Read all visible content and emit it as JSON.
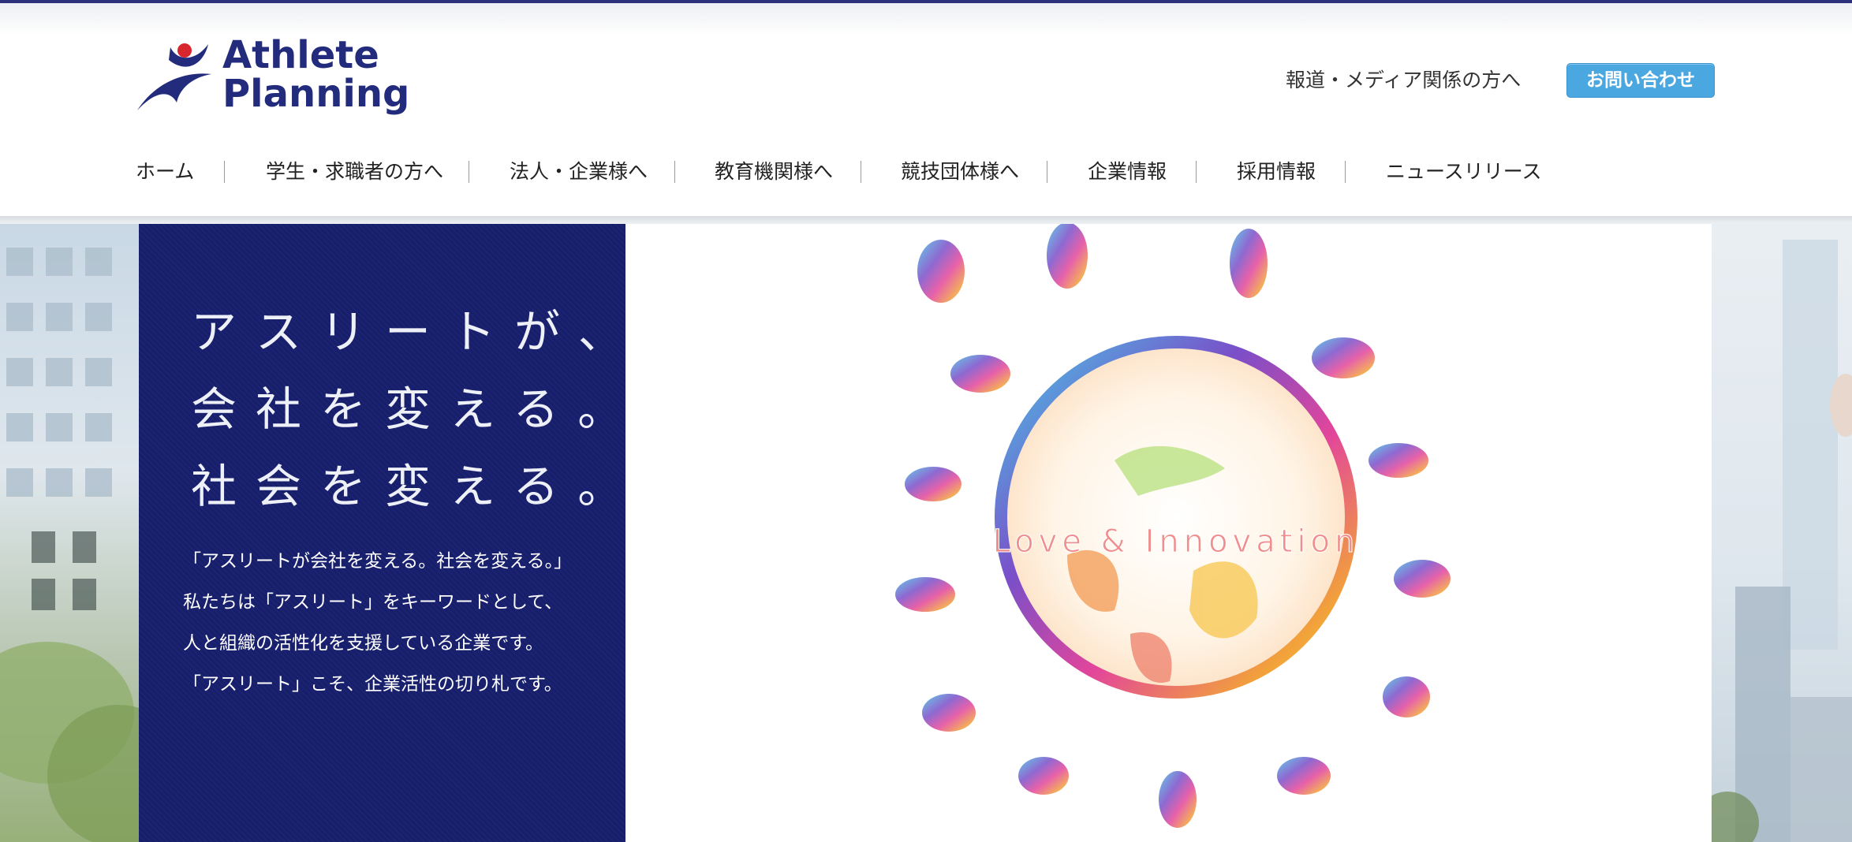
{
  "header": {
    "logo_line1": "Athlete",
    "logo_line2": "Planning",
    "media_link": "報道・メディア関係の方へ",
    "contact_button": "お問い合わせ"
  },
  "nav": {
    "items": [
      "ホーム",
      "学生・求職者の方へ",
      "法人・企業様へ",
      "教育機関様へ",
      "競技団体様へ",
      "企業情報",
      "採用情報",
      "ニュースリリース"
    ]
  },
  "hero": {
    "headline": [
      "アスリートが、",
      "会社を変える。",
      "社会を変える。"
    ],
    "body": [
      "「アスリートが会社を変える。社会を変える。」",
      "私たちは「アスリート」をキーワードとして、",
      "人と組織の活性化を支援している企業です。",
      "「アスリート」こそ、企業活性の切り札です。"
    ],
    "visual_caption": "Love & Innovation"
  },
  "colors": {
    "navy": "#171f6c",
    "logo_blue": "#232c7c",
    "accent_red": "#d7262e",
    "contact_blue": "#4aa7e0"
  }
}
